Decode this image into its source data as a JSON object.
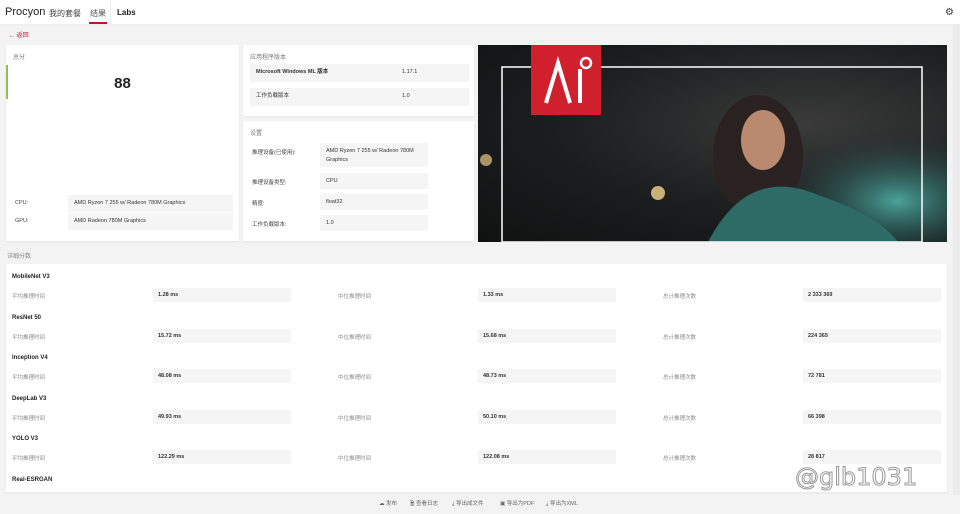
{
  "nav": {
    "brand": "Procyon",
    "tabs": [
      "我的套餐",
      "结果",
      "Labs"
    ],
    "settings_icon": "gear-icon"
  },
  "back": "← 返回",
  "score": {
    "title": "总分",
    "value": "88",
    "cpu_label": "CPU:",
    "cpu": "AMD Ryzen 7 255 w/ Radeon 780M Graphics",
    "gpu_label": "GPU:",
    "gpu": "AMD Radeon 780M Graphics"
  },
  "app_version": {
    "title": "应用程序版本",
    "rows": [
      {
        "label": "Microsoft Windows ML 版本",
        "value": "1.17.1"
      },
      {
        "label": "工作负载版本",
        "value": "1.0"
      }
    ]
  },
  "settings": {
    "title": "设置",
    "rows": [
      {
        "label": "推理设备(已使用):",
        "value": "AMD Ryzen 7 255 w/ Radeon 780M Graphics"
      },
      {
        "label": "推理设备类型:",
        "value": "CPU"
      },
      {
        "label": "精度:",
        "value": "float32"
      },
      {
        "label": "工作负载版本:",
        "value": "1.0"
      }
    ]
  },
  "details": {
    "title": "详细分数",
    "col_labels": [
      "平均推理时间",
      "中位推理时间",
      "总计推理次数"
    ],
    "models": [
      {
        "name": "MobileNet V3",
        "avg": "1.28 ms",
        "median": "1.33 ms",
        "total": "2 333 369"
      },
      {
        "name": "ResNet 50",
        "avg": "15.72 ms",
        "median": "15.68 ms",
        "total": "224 365"
      },
      {
        "name": "Inception V4",
        "avg": "48.08 ms",
        "median": "48.73 ms",
        "total": "72 781"
      },
      {
        "name": "DeepLab V3",
        "avg": "49.93 ms",
        "median": "50.10 ms",
        "total": "66 398"
      },
      {
        "name": "YOLO V3",
        "avg": "122.29 ms",
        "median": "122.08 ms",
        "total": "28 817"
      },
      {
        "name": "Real-ESRGAN"
      }
    ]
  },
  "footer": [
    {
      "icon": "cloud-icon",
      "label": "发布"
    },
    {
      "icon": "file-icon",
      "label": "查看日志"
    },
    {
      "icon": "download-icon",
      "label": "导出成文件"
    },
    {
      "icon": "save-icon",
      "label": "导出为PDF"
    },
    {
      "icon": "download-icon",
      "label": "导出为XML"
    }
  ],
  "watermark": "@glb1031",
  "colors": {
    "accent": "#c8102e",
    "score_bar": "#8bc34a"
  }
}
